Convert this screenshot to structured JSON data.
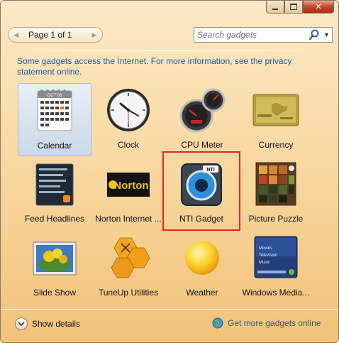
{
  "window": {
    "caption": {
      "minimize": "–",
      "maximize": "□",
      "close": "✕"
    }
  },
  "toolbar": {
    "page_label": "Page 1 of 1",
    "prev_icon": "chevron-left-icon",
    "next_icon": "chevron-right-icon",
    "search_placeholder": "Search gadgets"
  },
  "info": {
    "text": "Some gadgets access the Internet.  For more information, see the privacy statement online."
  },
  "gadgets": [
    {
      "label": "Calendar",
      "icon": "calendar-icon",
      "selected": true
    },
    {
      "label": "Clock",
      "icon": "clock-icon"
    },
    {
      "label": "CPU Meter",
      "icon": "cpu-meter-icon"
    },
    {
      "label": "Currency",
      "icon": "currency-icon"
    },
    {
      "label": "Feed Headlines",
      "icon": "feed-headlines-icon"
    },
    {
      "label": "Norton Internet ...",
      "icon": "norton-icon"
    },
    {
      "label": "NTI Gadget",
      "icon": "nti-gadget-icon",
      "highlighted": true
    },
    {
      "label": "Picture Puzzle",
      "icon": "picture-puzzle-icon"
    },
    {
      "label": "Slide Show",
      "icon": "slide-show-icon"
    },
    {
      "label": "TuneUp Utilities",
      "icon": "tuneup-icon"
    },
    {
      "label": "Weather",
      "icon": "weather-icon"
    },
    {
      "label": "Windows Media...",
      "icon": "windows-media-icon"
    }
  ],
  "thumb_text": {
    "calendar_month": "OCT 06",
    "norton": "Norton",
    "nti": "NTI",
    "media_lines": [
      "Movies",
      "Television",
      "Music"
    ]
  },
  "footer": {
    "show_details": "Show details",
    "more_online": "Get more gadgets online"
  },
  "colors": {
    "link": "#1e5aa8",
    "window_bg_top": "#fbe9c6",
    "window_bg_bottom": "#f3c27a",
    "highlight_border": "#e3262b"
  }
}
